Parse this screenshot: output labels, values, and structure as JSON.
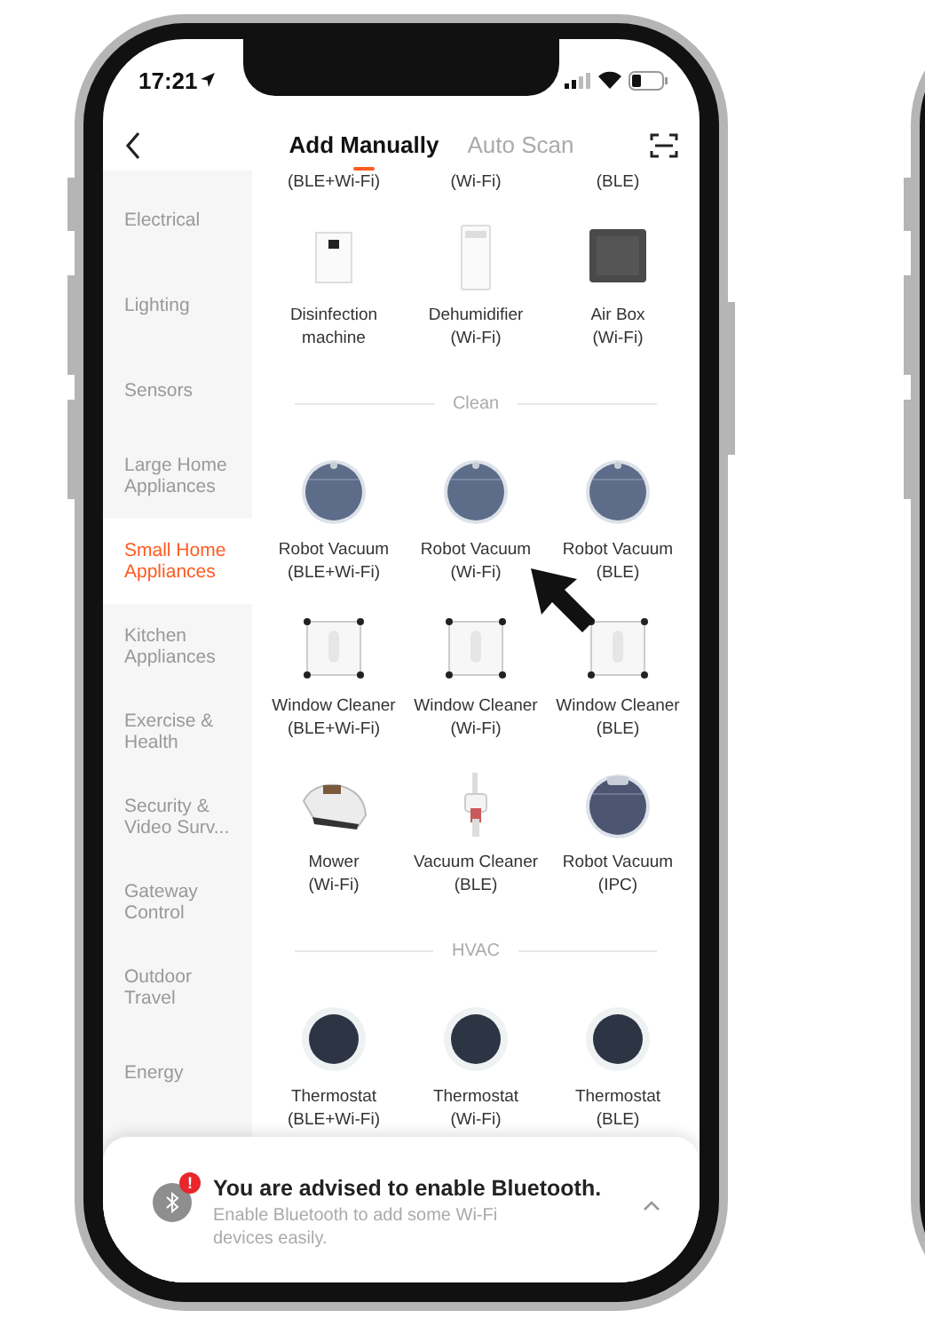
{
  "status_bar": {
    "time": "17:21"
  },
  "header": {
    "tabs": [
      {
        "label": "Add Manually",
        "selected": true
      },
      {
        "label": "Auto Scan",
        "selected": false
      }
    ]
  },
  "sidebar": {
    "items": [
      {
        "label": "Electrical",
        "selected": false
      },
      {
        "label": "Lighting",
        "selected": false
      },
      {
        "label": "Sensors",
        "selected": false
      },
      {
        "label": "Large Home Appliances",
        "selected": false
      },
      {
        "label": "Small Home Appliances",
        "selected": true
      },
      {
        "label": "Kitchen Appliances",
        "selected": false
      },
      {
        "label": "Exercise & Health",
        "selected": false
      },
      {
        "label": "Security & Video Surv...",
        "selected": false
      },
      {
        "label": "Gateway Control",
        "selected": false
      },
      {
        "label": "Outdoor Travel",
        "selected": false
      },
      {
        "label": "Energy",
        "selected": false
      }
    ]
  },
  "content": {
    "sections": [
      {
        "rows": [
          [
            {
              "protocol": "(BLE+Wi-Fi)"
            },
            {
              "protocol": "(Wi-Fi)"
            },
            {
              "protocol": "(BLE)"
            }
          ],
          [
            {
              "kind": "disinfection",
              "name": "Disinfection",
              "protocol": "machine"
            },
            {
              "kind": "dehumidifier",
              "name": "Dehumidifier",
              "protocol": "(Wi-Fi)"
            },
            {
              "kind": "airbox",
              "name": "Air Box",
              "protocol": "(Wi-Fi)"
            }
          ]
        ]
      },
      {
        "title": "Clean",
        "rows": [
          [
            {
              "kind": "robot",
              "name": "Robot Vacuum",
              "protocol": "(BLE+Wi-Fi)"
            },
            {
              "kind": "robot",
              "name": "Robot Vacuum",
              "protocol": "(Wi-Fi)"
            },
            {
              "kind": "robot",
              "name": "Robot Vacuum",
              "protocol": "(BLE)"
            }
          ],
          [
            {
              "kind": "window",
              "name": "Window Cleaner",
              "protocol": "(BLE+Wi-Fi)"
            },
            {
              "kind": "window",
              "name": "Window Cleaner",
              "protocol": "(Wi-Fi)"
            },
            {
              "kind": "window",
              "name": "Window Cleaner",
              "protocol": "(BLE)"
            }
          ],
          [
            {
              "kind": "mower",
              "name": "Mower",
              "protocol": "(Wi-Fi)"
            },
            {
              "kind": "stickvac",
              "name": "Vacuum Cleaner",
              "protocol": "(BLE)"
            },
            {
              "kind": "robotcam",
              "name": "Robot Vacuum",
              "protocol": "(IPC)"
            }
          ]
        ]
      },
      {
        "title": "HVAC",
        "rows": [
          [
            {
              "kind": "thermostat",
              "name": "Thermostat",
              "protocol": "(BLE+Wi-Fi)"
            },
            {
              "kind": "thermostat",
              "name": "Thermostat",
              "protocol": "(Wi-Fi)"
            },
            {
              "kind": "thermostat",
              "name": "Thermostat",
              "protocol": "(BLE)"
            }
          ]
        ]
      }
    ]
  },
  "banner": {
    "badge": "!",
    "title": "You are advised to enable Bluetooth.",
    "message": "Enable Bluetooth to add some Wi-Fi devices easily."
  }
}
